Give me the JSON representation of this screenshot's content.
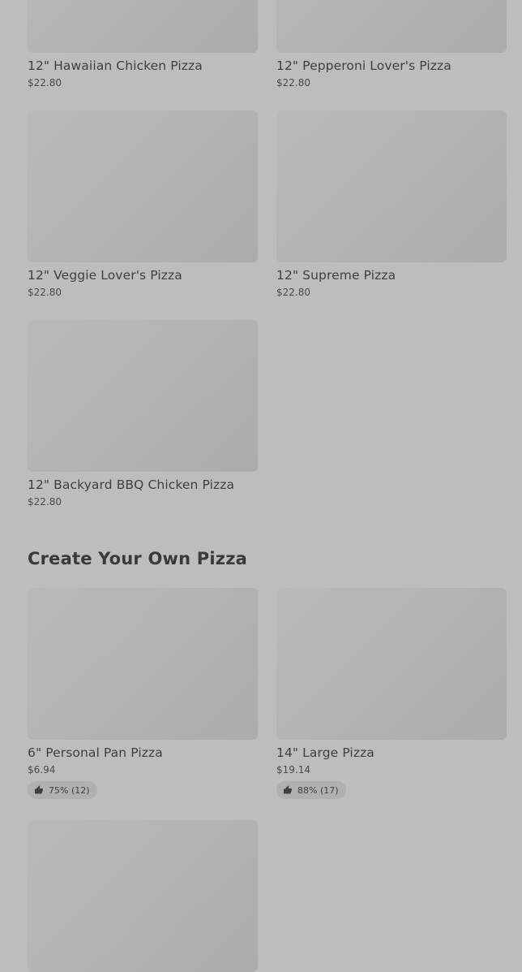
{
  "products_top": [
    {
      "name": "12\" Hawaiian Chicken Pizza",
      "price": "$22.80"
    },
    {
      "name": "12\" Pepperoni Lover's Pizza",
      "price": "$22.80"
    },
    {
      "name": "12\" Veggie Lover's Pizza",
      "price": "$22.80"
    },
    {
      "name": "12\" Supreme Pizza",
      "price": "$22.80"
    },
    {
      "name": "12\" Backyard BBQ Chicken Pizza",
      "price": "$22.80"
    }
  ],
  "create_section": {
    "title": "Create Your Own Pizza",
    "items": [
      {
        "name": "6\" Personal Pan Pizza",
        "price": "$6.94",
        "rating": "75% (12)",
        "rating_icon": "thumbs-up-icon"
      },
      {
        "name": "14\" Large Pizza",
        "price": "$19.14",
        "rating": "88% (17)",
        "rating_icon": "thumbs-up-icon"
      }
    ]
  }
}
